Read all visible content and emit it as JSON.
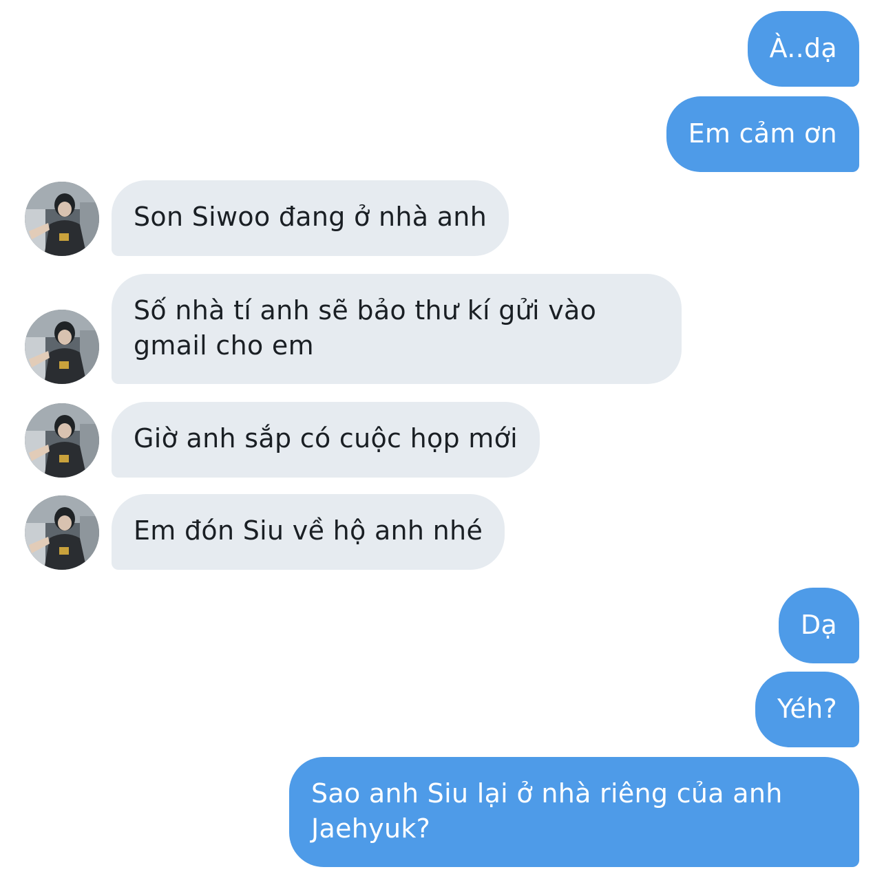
{
  "conversation": {
    "messages": [
      {
        "side": "sent",
        "text": "À..dạ"
      },
      {
        "side": "sent",
        "text": "Em cảm ơn"
      },
      {
        "side": "received",
        "text": "Son Siwoo đang ở nhà anh"
      },
      {
        "side": "received",
        "text": "Số nhà tí anh sẽ bảo thư kí gửi vào gmail cho em"
      },
      {
        "side": "received",
        "text": "Giờ anh sắp có cuộc họp mới"
      },
      {
        "side": "received",
        "text": "Em đón Siu về hộ anh nhé"
      },
      {
        "side": "sent",
        "text": "Dạ"
      },
      {
        "side": "sent",
        "text": "Yéh?"
      },
      {
        "side": "sent",
        "text": "Sao anh Siu lại ở nhà riêng của anh Jaehyuk?"
      }
    ]
  },
  "colors": {
    "sent_bubble": "#4e9be8",
    "received_bubble": "#e6ebf0",
    "sent_text": "#ffffff",
    "received_text": "#1a1f24"
  }
}
